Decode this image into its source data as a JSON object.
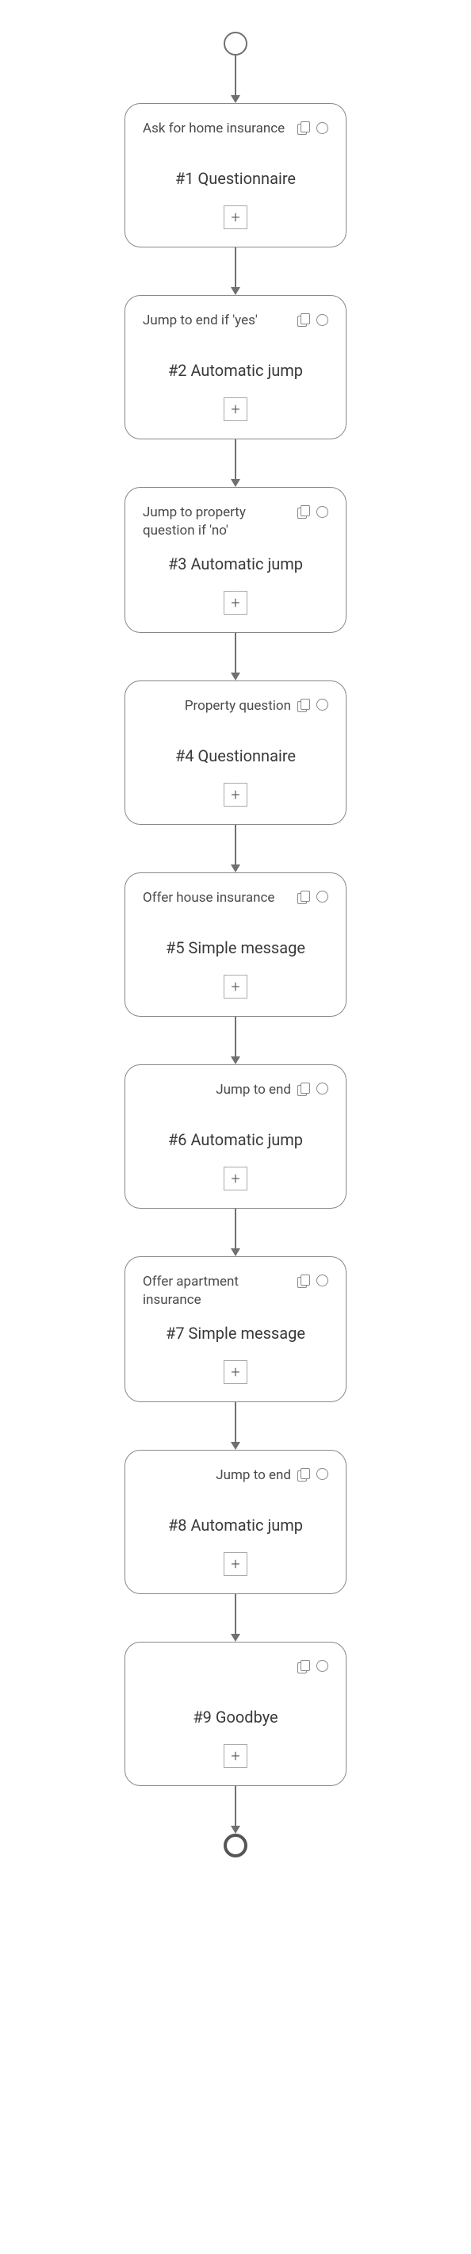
{
  "flow": {
    "nodes": [
      {
        "title": "Ask for home insurance",
        "title_align": "left",
        "subtitle": "#1 Questionnaire"
      },
      {
        "title": "Jump to end if 'yes'",
        "title_align": "left",
        "subtitle": "#2 Automatic jump"
      },
      {
        "title": "Jump to property question if 'no'",
        "title_align": "left",
        "subtitle": "#3 Automatic jump"
      },
      {
        "title": "Property question",
        "title_align": "right",
        "subtitle": "#4 Questionnaire"
      },
      {
        "title": "Offer house insurance",
        "title_align": "left",
        "subtitle": "#5 Simple message"
      },
      {
        "title": "Jump to end",
        "title_align": "right",
        "subtitle": "#6 Automatic jump"
      },
      {
        "title": "Offer apartment insurance",
        "title_align": "left",
        "subtitle": "#7 Simple message"
      },
      {
        "title": "Jump to end",
        "title_align": "right",
        "subtitle": "#8 Automatic jump"
      },
      {
        "title": "",
        "title_align": "left",
        "subtitle": "#9 Goodbye"
      }
    ],
    "expand_label": "+"
  }
}
